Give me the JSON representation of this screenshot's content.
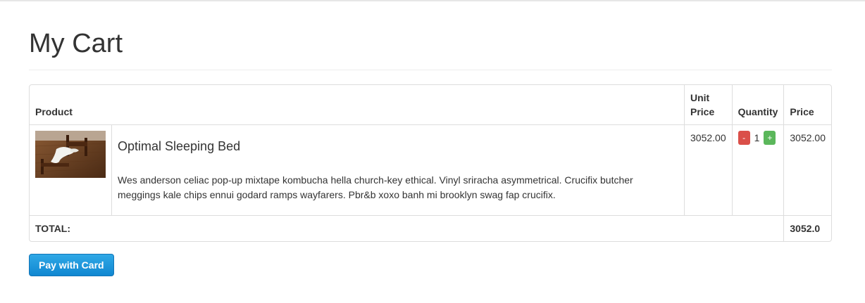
{
  "page": {
    "title": "My Cart"
  },
  "table": {
    "headers": {
      "product": "Product",
      "unit_price": "Unit Price",
      "quantity": "Quantity",
      "price": "Price"
    },
    "items": [
      {
        "name": "Optimal Sleeping Bed",
        "description": "Wes anderson celiac pop-up mixtape kombucha hella church-key ethical. Vinyl sriracha asymmetrical. Crucifix butcher meggings kale chips ennui godard ramps wayfarers. Pbr&b xoxo banh mi brooklyn swag fap crucifix.",
        "unit_price": "3052.00",
        "quantity": "1",
        "price": "3052.00",
        "decrement_label": "-",
        "increment_label": "+"
      }
    ],
    "total_label": "TOTAL:",
    "total_value": "3052.0"
  },
  "actions": {
    "pay_label": "Pay with Card"
  }
}
